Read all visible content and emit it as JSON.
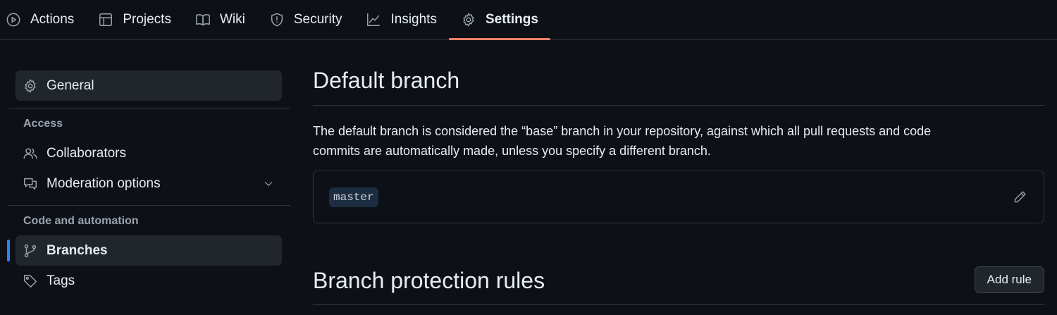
{
  "topnav": {
    "tabs": [
      {
        "label": "Actions",
        "icon": "play-circle-icon"
      },
      {
        "label": "Projects",
        "icon": "table-icon"
      },
      {
        "label": "Wiki",
        "icon": "book-icon"
      },
      {
        "label": "Security",
        "icon": "shield-icon"
      },
      {
        "label": "Insights",
        "icon": "graph-icon"
      },
      {
        "label": "Settings",
        "icon": "gear-icon",
        "active": true
      }
    ],
    "accent_color": "#f78166"
  },
  "sidebar": {
    "general": "General",
    "access_heading": "Access",
    "collaborators": "Collaborators",
    "moderation": "Moderation options",
    "code_heading": "Code and automation",
    "branches": "Branches",
    "tags": "Tags",
    "selected_indicator_color": "#2f81f7"
  },
  "main": {
    "default_branch_title": "Default branch",
    "default_branch_desc_1": "The default branch is considered the “base” branch in your repository, against which all pull requests and code",
    "default_branch_desc_2": "commits are automatically made, unless you specify a different branch.",
    "branch_name": "master",
    "protection_title": "Branch protection rules",
    "add_rule_label": "Add rule"
  }
}
